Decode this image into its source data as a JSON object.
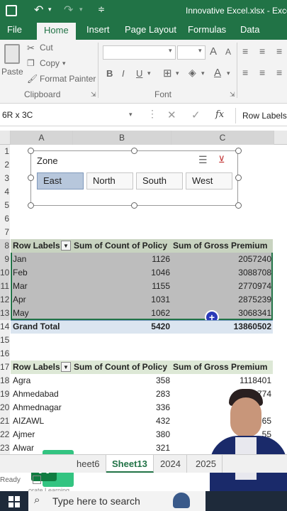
{
  "title_bar": {
    "filename": "Innovative Excel.xlsx - Excel"
  },
  "menu": {
    "tabs": [
      "File",
      "Home",
      "Insert",
      "Page Layout",
      "Formulas",
      "Data"
    ],
    "active": "Home"
  },
  "ribbon": {
    "paste": "Paste",
    "cut": "Cut",
    "copy": "Copy",
    "format_painter": "Format Painter",
    "clipboard_group": "Clipboard",
    "font_group": "Font",
    "bold": "B",
    "italic": "I",
    "underline": "U",
    "font_grow": "A",
    "font_shrink": "A"
  },
  "formula_bar": {
    "name_box": "6R x 3C",
    "fx": "fx",
    "content": "Row Labels"
  },
  "columns": [
    "A",
    "B",
    "C"
  ],
  "rows": [
    "1",
    "2",
    "3",
    "4",
    "5",
    "6",
    "7",
    "8",
    "9",
    "10",
    "11",
    "12",
    "13",
    "14",
    "15",
    "16",
    "17",
    "18",
    "19",
    "20",
    "21",
    "22",
    "23"
  ],
  "slicer": {
    "title": "Zone",
    "items": [
      "East",
      "North",
      "South",
      "West"
    ],
    "selected": "East"
  },
  "pivot1": {
    "headers": [
      "Row Labels",
      "Sum of Count of Policy",
      "Sum of Gross Premium"
    ],
    "rows": [
      {
        "label": "Jan",
        "count": "1126",
        "premium": "2057240"
      },
      {
        "label": "Feb",
        "count": "1046",
        "premium": "3088708"
      },
      {
        "label": "Mar",
        "count": "1155",
        "premium": "2770974"
      },
      {
        "label": "Apr",
        "count": "1031",
        "premium": "2875239"
      },
      {
        "label": "May",
        "count": "1062",
        "premium": "3068341"
      }
    ],
    "total": {
      "label": "Grand Total",
      "count": "5420",
      "premium": "13860502"
    }
  },
  "pivot2": {
    "headers": [
      "Row Labels",
      "Sum of Count of Policy",
      "Sum of Gross Premium"
    ],
    "rows": [
      {
        "label": "Agra",
        "count": "358",
        "premium": "1118401"
      },
      {
        "label": "Ahmedabad",
        "count": "283",
        "premium": "774"
      },
      {
        "label": "Ahmednagar",
        "count": "336",
        "premium": ""
      },
      {
        "label": "AIZAWL",
        "count": "432",
        "premium": "65"
      },
      {
        "label": "Ajmer",
        "count": "380",
        "premium": "55"
      },
      {
        "label": "Alwar",
        "count": "321",
        "premium": ""
      }
    ]
  },
  "sheet_tabs": [
    "heet6",
    "Sheet13",
    "2024",
    "2025"
  ],
  "active_sheet": "Sheet13",
  "status": {
    "ready": "Ready",
    "watermark": "orate Learning"
  },
  "taskbar": {
    "search_placeholder": "Type here to search"
  },
  "colors": {
    "excel_green": "#217346",
    "selection": "#a6a6a6",
    "pivot_header": "#dde8d6"
  }
}
